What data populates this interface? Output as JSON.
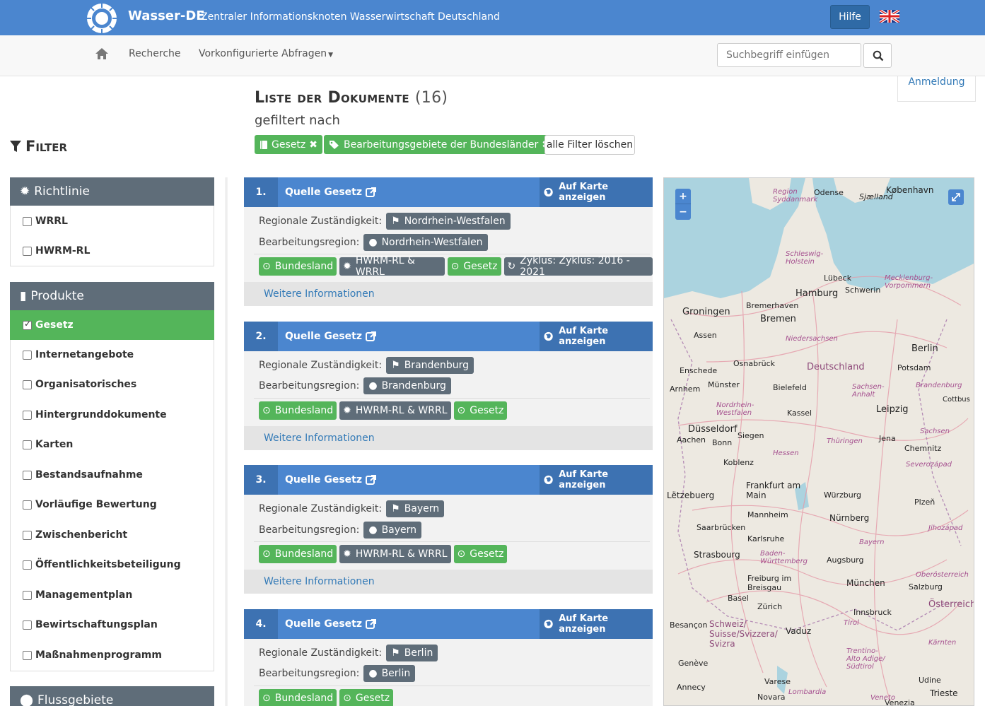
{
  "header": {
    "brand": "Wasser-DE",
    "subtitle": "Zentraler Informationsknoten Wasserwirtschaft Deutschland",
    "help_label": "Hilfe",
    "language_icon": "uk-flag-icon"
  },
  "nav": {
    "research": "Recherche",
    "preconfigured": "Vorkonfigurierte Abfragen",
    "search_placeholder": "Suchbegriff einfügen"
  },
  "login_label": "Anmeldung",
  "list": {
    "title": "Liste der Dokumente",
    "count": "(16)",
    "filtered_by": "gefiltert nach",
    "active_filters": [
      "Gesetz",
      "Bearbeitungsgebiete der Bundesländer"
    ],
    "clear_all": "alle Filter löschen"
  },
  "sidebar": {
    "title": "Filter",
    "groups": [
      {
        "label": "Richtlinie",
        "items": [
          {
            "label": "WRRL",
            "checked": false
          },
          {
            "label": "HWRM-RL",
            "checked": false
          }
        ]
      },
      {
        "label": "Produkte",
        "items": [
          {
            "label": "Gesetz",
            "checked": true
          },
          {
            "label": "Internetangebote",
            "checked": false
          },
          {
            "label": "Organisatorisches",
            "checked": false
          },
          {
            "label": "Hintergrunddokumente",
            "checked": false
          },
          {
            "label": "Karten",
            "checked": false
          },
          {
            "label": "Bestandsaufnahme",
            "checked": false
          },
          {
            "label": "Vorläufige Bewertung",
            "checked": false
          },
          {
            "label": "Zwischenbericht",
            "checked": false
          },
          {
            "label": "Öffentlichkeitsbeteiligung",
            "checked": false
          },
          {
            "label": "Managementplan",
            "checked": false
          },
          {
            "label": "Bewirtschaftungsplan",
            "checked": false
          },
          {
            "label": "Maßnahmenprogramm",
            "checked": false
          }
        ]
      },
      {
        "label": "Flussgebiete",
        "items": []
      }
    ]
  },
  "results": [
    {
      "num": "1.",
      "title": "Quelle Gesetz",
      "map_label": "Auf Karte anzeigen",
      "responsibility_label": "Regionale Zuständigkeit:",
      "responsibility": "Nordrhein-Westfalen",
      "region_label": "Bearbeitungsregion:",
      "region": "Nordrhein-Westfalen",
      "tags": [
        "Bundesland",
        "HWRM-RL & WRRL",
        "Gesetz"
      ],
      "cycle": "Zyklus: Zyklus: 2016 - 2021",
      "more": "Weitere Informationen"
    },
    {
      "num": "2.",
      "title": "Quelle Gesetz",
      "map_label": "Auf Karte anzeigen",
      "responsibility_label": "Regionale Zuständigkeit:",
      "responsibility": "Brandenburg",
      "region_label": "Bearbeitungsregion:",
      "region": "Brandenburg",
      "tags": [
        "Bundesland",
        "HWRM-RL & WRRL",
        "Gesetz"
      ],
      "cycle": "",
      "more": "Weitere Informationen"
    },
    {
      "num": "3.",
      "title": "Quelle Gesetz",
      "map_label": "Auf Karte anzeigen",
      "responsibility_label": "Regionale Zuständigkeit:",
      "responsibility": "Bayern",
      "region_label": "Bearbeitungsregion:",
      "region": "Bayern",
      "tags": [
        "Bundesland",
        "HWRM-RL & WRRL",
        "Gesetz"
      ],
      "cycle": "",
      "more": "Weitere Informationen"
    },
    {
      "num": "4.",
      "title": "Quelle Gesetz",
      "map_label": "Auf Karte anzeigen",
      "responsibility_label": "Regionale Zuständigkeit:",
      "responsibility": "Berlin",
      "region_label": "Bearbeitungsregion:",
      "region": "Berlin",
      "tags": [
        "Bundesland",
        "Gesetz"
      ],
      "cycle": "",
      "more": "Weitere Informationen"
    }
  ],
  "map": {
    "zoom_in": "+",
    "zoom_out": "−",
    "labels": {
      "kobenhavn": "København",
      "sjaelland": "Sjælland",
      "odense": "Odense",
      "region_syd": "Region Syddanmark",
      "schleswig": "Schleswig-Holstein",
      "lubeck": "Lübeck",
      "hamburg": "Hamburg",
      "schwerin": "Schwerin",
      "meck": "Mecklenburg-Vorpommern",
      "groningen": "Groningen",
      "bremerhaven": "Bremerhaven",
      "bremen": "Bremen",
      "assen": "Assen",
      "niedersachsen": "Niedersachsen",
      "berlin": "Berlin",
      "potsdam": "Potsdam",
      "osnabruck": "Osnabrück",
      "deutschland": "Deutschland",
      "enschede": "Enschede",
      "bielefeld": "Bielefeld",
      "arnhem": "Arnhem",
      "munster": "Münster",
      "sachsen_anhalt": "Sachsen-Anhalt",
      "brandenburg": "Brandenburg",
      "cottbus": "Cottbus",
      "nrw": "Nordrhein-Westfalen",
      "kassel": "Kassel",
      "leipzig": "Leipzig",
      "dusseldorf": "Düsseldorf",
      "siegen": "Siegen",
      "aachen": "Aachen",
      "bonn": "Bonn",
      "sachsen": "Sachsen",
      "thuringen": "Thüringen",
      "jena": "Jena",
      "chemnitz": "Chemnitz",
      "hessen": "Hessen",
      "koblenz": "Koblenz",
      "severozapad": "Severozápad",
      "frankfurt": "Frankfurt am Main",
      "wurzburg": "Würzburg",
      "plzen": "Plzeň",
      "letzeburg": "Lëtzebuerg",
      "mannheim": "Mannheim",
      "nurnberg": "Nürnberg",
      "saarbrucken": "Saarbrücken",
      "karlsruhe": "Karlsruhe",
      "jihozapad": "Jihozápad",
      "bayern": "Bayern",
      "strasbourg": "Strasbourg",
      "bw": "Baden-Württemberg",
      "augsburg": "Augsburg",
      "oberosterreich": "Oberösterreich",
      "freiburg": "Freiburg im Breisgau",
      "munchen": "München",
      "salzburg": "Salzburg",
      "basel": "Basel",
      "zurich": "Zürich",
      "osterreich": "Österreich",
      "innsbruck": "Innsbruck",
      "besancon": "Besançon",
      "schweiz": "Schweiz/ Suisse/Svizzera/ Svizra",
      "vaduz": "Vaduz",
      "tirol": "Tirol",
      "karnten": "Kärnten",
      "trentino": "Trentino-Alto Adige/ Südtirol",
      "geneve": "Genève",
      "annecy": "Annecy",
      "varese": "Varese",
      "lombardia": "Lombardia",
      "novara": "Novara",
      "veneto": "Veneto",
      "udine": "Udine",
      "trieste": "Trieste",
      "venezia": "Venezia"
    }
  }
}
